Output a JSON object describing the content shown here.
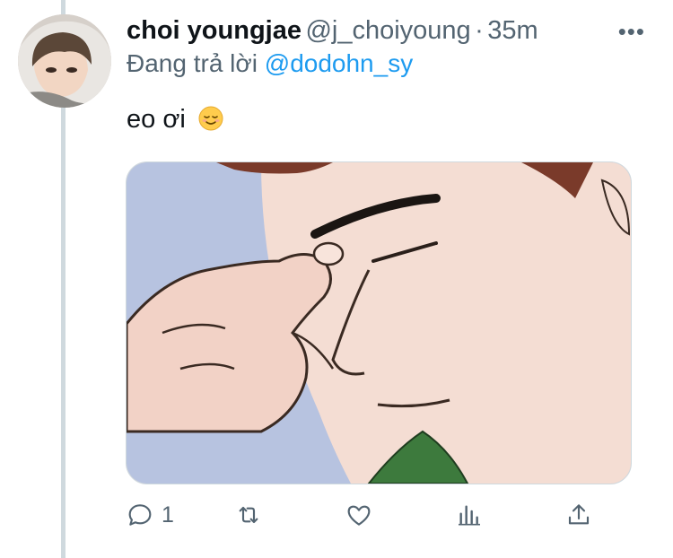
{
  "tweet": {
    "display_name": "choi youngjae",
    "handle": "@j_choiyoung",
    "separator": "·",
    "time": "35m",
    "more_glyph": "•••",
    "reply_prefix": "Đang trả lời",
    "reply_mention": "@dodohn_sy",
    "text": "eo ơi",
    "emoji": "relieved-face-emoji"
  },
  "media": {
    "description_icon": "facepalm-illustration"
  },
  "actions": {
    "reply_count": "1",
    "icons": [
      "reply-icon",
      "retweet-icon",
      "like-icon",
      "analytics-icon",
      "share-icon"
    ]
  },
  "colors": {
    "text_primary": "#0f1419",
    "text_secondary": "#536471",
    "link": "#1d9bf0",
    "thread_line": "#cfd9de"
  }
}
